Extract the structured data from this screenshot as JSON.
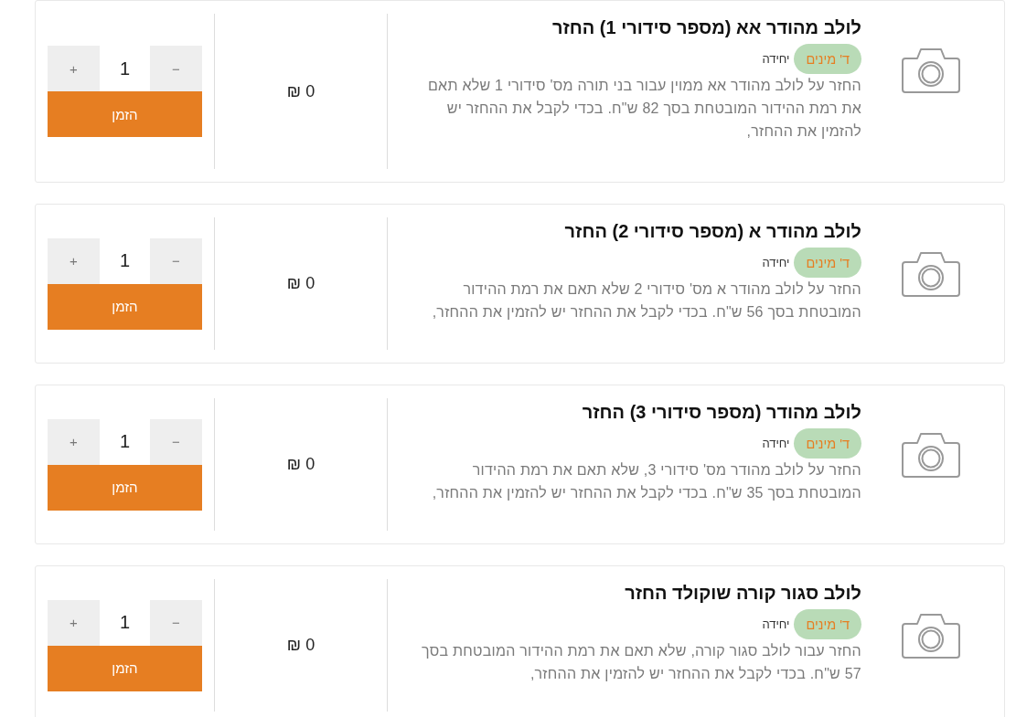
{
  "products": [
    {
      "title": "לולב מהודר אא (מספר סידורי 1) החזר",
      "tag": "ד' מינים",
      "unit": "יחידה",
      "description": "החזר על לולב מהודר אא ממוין עבור בני תורה מס' סידורי 1 שלא תאם את רמת ההידור המובטחת בסך 82 ש\"ח. בכדי לקבל את ההחזר יש להזמין את ההחזר,",
      "price": "0 ₪",
      "decrement": "−",
      "quantity": "1",
      "increment": "+",
      "order_button": "הזמן"
    },
    {
      "title": "לולב מהודר א (מספר סידורי 2) החזר",
      "tag": "ד' מינים",
      "unit": "יחידה",
      "description": "החזר על לולב מהודר א מס' סידורי 2 שלא תאם את רמת ההידור המובטחת בסך 56 ש\"ח. בכדי לקבל את ההחזר יש להזמין את ההחזר,",
      "price": "0 ₪",
      "decrement": "−",
      "quantity": "1",
      "increment": "+",
      "order_button": "הזמן"
    },
    {
      "title": "לולב מהודר (מספר סידורי 3) החזר",
      "tag": "ד' מינים",
      "unit": "יחידה",
      "description": "החזר על לולב מהודר מס' סידורי 3, שלא תאם את רמת ההידור המובטחת בסך 35 ש\"ח. בכדי לקבל את ההחזר יש להזמין את ההחזר,",
      "price": "0 ₪",
      "decrement": "−",
      "quantity": "1",
      "increment": "+",
      "order_button": "הזמן"
    },
    {
      "title": "לולב סגור קורה שוקולד החזר",
      "tag": "ד' מינים",
      "unit": "יחידה",
      "description": "החזר עבור לולב סגור קורה, שלא תאם את רמת ההידור המובטחת בסך 57 ש\"ח. בכדי לקבל את ההחזר יש להזמין את ההחזר,",
      "price": "0 ₪",
      "decrement": "−",
      "quantity": "1",
      "increment": "+",
      "order_button": "הזמן"
    }
  ]
}
